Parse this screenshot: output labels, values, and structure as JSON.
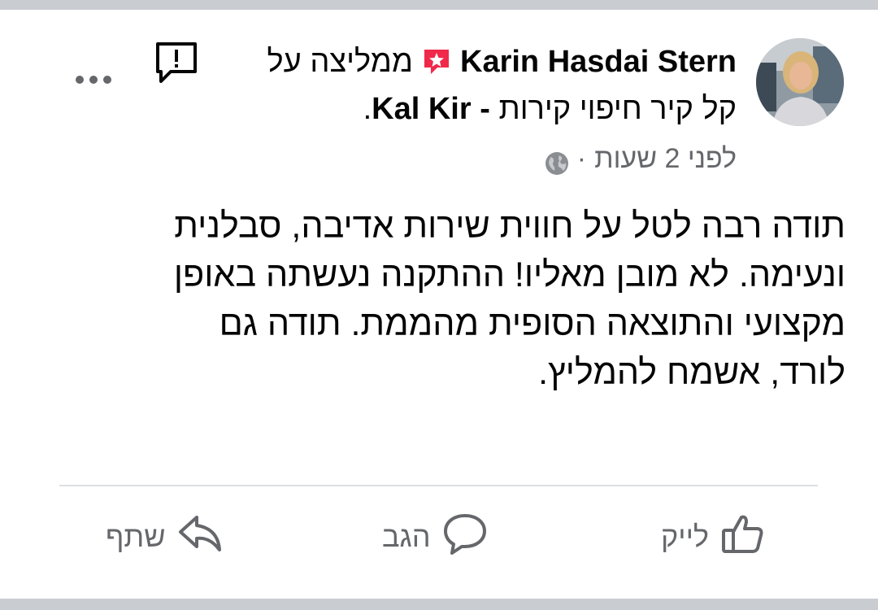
{
  "post": {
    "author": "Karin Hasdai Stern",
    "recommends_text": "ממליצה על",
    "page_name": "Kal Kir -",
    "page_hebrew": "קל קיר חיפוי קירות",
    "page_period": ".",
    "time": "לפני 2 שעות",
    "separator": "·",
    "body": "תודה רבה לטל על חווית שירות אדיבה, סבלנית ונעימה. לא מובן מאליו! ההתקנה נעשתה באופן מקצועי והתוצאה הסופית מהממת. תודה גם לורד, אשמח להמליץ."
  },
  "actions": {
    "like": "לייק",
    "comment": "הגב",
    "share": "שתף"
  },
  "icons": {
    "recommend": "recommend-badge-icon",
    "privacy": "globe-icon",
    "report": "report-icon",
    "more": "more-options-icon",
    "like": "thumbs-up-icon",
    "comment": "comment-bubble-icon",
    "share": "share-arrow-icon"
  },
  "colors": {
    "text": "#050505",
    "secondary": "#65676b",
    "recommend_badge": "#f02849",
    "band": "#c9ccd1"
  }
}
